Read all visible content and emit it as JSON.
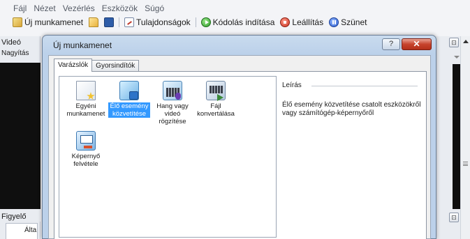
{
  "app": {
    "menu": [
      "Fájl",
      "Nézet",
      "Vezérlés",
      "Eszközök",
      "Súgó"
    ],
    "toolbar": {
      "new_session": "Új munkamenet",
      "properties": "Tulajdonságok",
      "start_encoding": "Kódolás indítása",
      "stop": "Leállítás",
      "pause": "Szünet"
    },
    "panels": {
      "video": "Videó",
      "zoom": "Nagyítás",
      "monitor": "Figyelő",
      "general_tab": "Álta"
    }
  },
  "dialog": {
    "title": "Új munkamenet",
    "help_button": "?",
    "close_button": "✕",
    "tabs": [
      "Varázslók",
      "Gyorsindítók"
    ],
    "wizards": [
      {
        "label": "Egyéni munkamenet",
        "icon": "custom-session-icon",
        "selected": false
      },
      {
        "label": "Élő esemény közvetítése",
        "icon": "live-broadcast-icon",
        "selected": true
      },
      {
        "label": "Hang vagy videó rögzítése",
        "icon": "record-av-icon",
        "selected": false
      },
      {
        "label": "Fájl konvertálása",
        "icon": "convert-file-icon",
        "selected": false
      },
      {
        "label": "Képernyő felvétele",
        "icon": "screen-capture-icon",
        "selected": false
      }
    ],
    "description": {
      "heading": "Leírás",
      "text": "Élő esemény közvetítése csatolt eszközökről vagy számítógép-képernyőről"
    }
  }
}
